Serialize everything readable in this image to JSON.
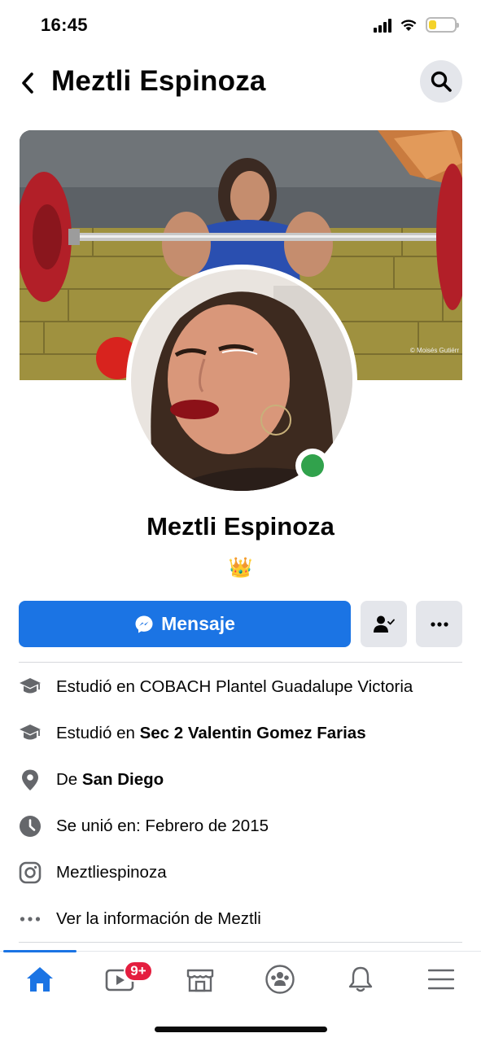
{
  "status_bar": {
    "time": "16:45",
    "icons": [
      "signal-icon",
      "wifi-icon",
      "battery-icon"
    ],
    "battery_level": 0.3
  },
  "header": {
    "title": "Meztli Espinoza",
    "back_icon": "chevron-left-icon",
    "search_icon": "search-icon"
  },
  "cover": {
    "credit": "© Moisés Gutiérr"
  },
  "profile": {
    "name": "Meztli Espinoza",
    "bio_emoji": "👑",
    "online": true
  },
  "actions": {
    "message_label": "Mensaje",
    "message_icon": "messenger-icon",
    "friend_icon": "friend-check-icon",
    "more_icon": "more-dots-icon"
  },
  "info": [
    {
      "icon": "education-icon",
      "prefix": "Estudió en COBACH Plantel Guadalupe Victoria",
      "bold": ""
    },
    {
      "icon": "education-icon",
      "prefix": "Estudió en ",
      "bold": "Sec 2 Valentin Gomez Farias"
    },
    {
      "icon": "location-icon",
      "prefix": "De ",
      "bold": "San Diego"
    },
    {
      "icon": "clock-icon",
      "prefix": "Se unió en: Febrero de 2015",
      "bold": ""
    },
    {
      "icon": "instagram-icon",
      "prefix": "Meztliespinoza",
      "bold": ""
    },
    {
      "icon": "more-dots-icon",
      "prefix": "Ver la información de Meztli",
      "bold": ""
    }
  ],
  "bottom_nav": {
    "items": [
      "home-icon",
      "watch-icon",
      "marketplace-icon",
      "groups-icon",
      "notifications-icon",
      "menu-icon"
    ],
    "active": "home-icon",
    "watch_badge": "9+"
  },
  "colors": {
    "accent": "#1b74e4",
    "online": "#31a24c",
    "badge": "#e41e3f",
    "icon_gray": "#65676b"
  }
}
